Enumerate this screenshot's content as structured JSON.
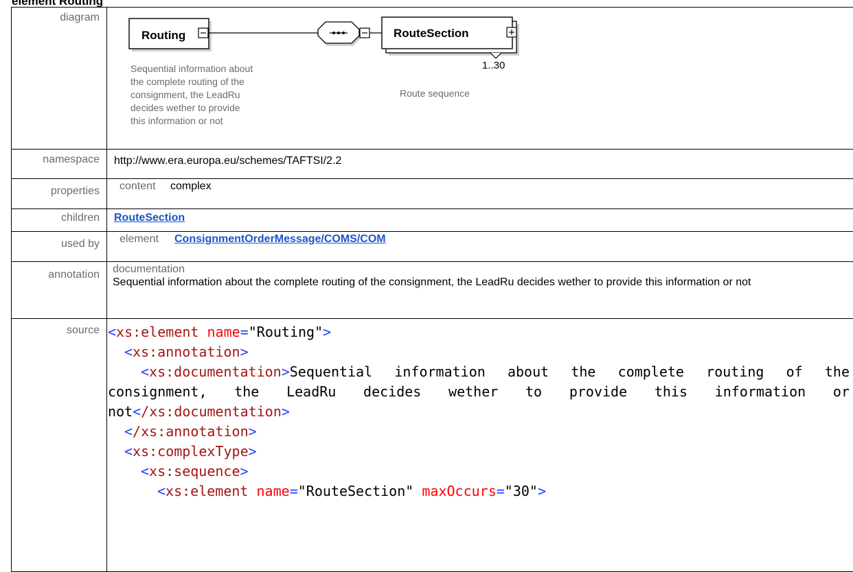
{
  "heading": "element Routing",
  "labels": {
    "diagram": "diagram",
    "namespace": "namespace",
    "properties": "properties",
    "children": "children",
    "used_by": "used by",
    "annotation": "annotation",
    "source": "source"
  },
  "diagram": {
    "root_box": "Routing",
    "root_doc": [
      "Sequential information about",
      "the complete routing of the",
      "consignment, the LeadRu",
      "decides wether to provide",
      "this information or not"
    ],
    "child_box": "RouteSection",
    "child_occurs": "1..30",
    "child_doc": "Route sequence"
  },
  "namespace": "http://www.era.europa.eu/schemes/TAFTSI/2.2",
  "properties": {
    "key": "content",
    "value": "complex"
  },
  "children": [
    "RouteSection"
  ],
  "used_by": {
    "key": "element",
    "value": "ConsignmentOrderMessage/COMS/COM"
  },
  "annotation": {
    "title": "documentation",
    "text": "Sequential information about the complete routing of the consignment, the LeadRu  decides wether to provide this information or not"
  },
  "source": {
    "l1_tag": "xs:element",
    "l1_attr": "name",
    "l1_val": "\"Routing\"",
    "l2_tag": "xs:annotation",
    "l3_tag_open": "xs:documentation",
    "l3_text": "Sequential information about the complete routing of the consignment, the LeadRu  decides wether to provide this information or not",
    "l3_tag_close": "/xs:documentation",
    "l4_tag": "/xs:annotation",
    "l5_tag": "xs:complexType",
    "l6_tag": "xs:sequence",
    "l7_tag": "xs:element",
    "l7_attr1": "name",
    "l7_val1": "\"RouteSection\"",
    "l7_attr2": "maxOccurs",
    "l7_val2": "\"30\""
  },
  "colors": {
    "link": "#1a56c8",
    "xml_tag": "#a31515",
    "xml_bracket": "#1f3fff",
    "xml_attr": "#ff0000",
    "label_gray": "#6b6b6b"
  }
}
